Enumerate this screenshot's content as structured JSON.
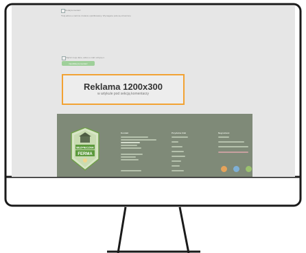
{
  "header": {
    "author_label": "Dodaj komentarz",
    "intro_text": "Twój adres e-mail nie zostanie opublikowany. Wymagane pola są oznaczone"
  },
  "comment_form": {
    "checkbox_label": "Zapisz moje dane, adres e-mail i witrynę w przeglądarce aby wypełnić dane podczas pisania kolejnych moich komentarzy.",
    "submit_label": "Opublikuj komentarz"
  },
  "ad": {
    "title": "Reklama 1200x300",
    "subtitle": "w artykule pod sekcją komentarzy"
  },
  "footer": {
    "logo_line1": "BEZPIECZNA",
    "logo_line2": "FERMA",
    "col1_title": "Kontakt",
    "col2_title": "Przydatne linki",
    "col3_title": "Nagrodzeni"
  },
  "colors": {
    "ad_border": "#f2a233",
    "submit_button": "#9fd09a",
    "footer_bg": "#7f8a78",
    "logo_green": "#5c9a3c"
  }
}
